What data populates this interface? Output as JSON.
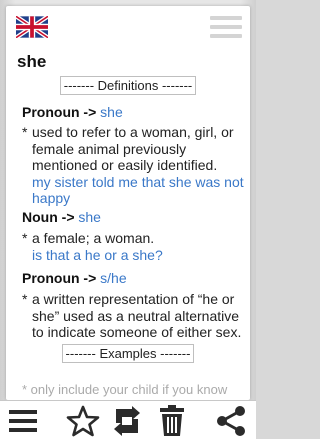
{
  "header": {
    "flag_icon": "uk-flag-icon",
    "menu_icon": "menu-lines-icon"
  },
  "entry": {
    "word": "she",
    "definitions_label": "------- Definitions -------",
    "examples_label": "------- Examples -------",
    "truncated_text": "* only include your child if you know"
  },
  "senses": [
    {
      "label": "Pronoun ->",
      "link": "she",
      "definition": "used to refer to a woman, girl, or female animal previously mentioned or easily identified.",
      "example": "my sister told me that she was not happy"
    },
    {
      "label": "Noun ->",
      "link": "she",
      "definition": "a female; a woman.",
      "example": "is that a he or a she?"
    },
    {
      "label": "Pronoun ->",
      "link": "s/he",
      "definition": "a written representation of “he or she” used as a neutral alternative to indicate someone of either sex.",
      "example": ""
    }
  ],
  "bullet": "*",
  "toolbar": {
    "items": [
      "menu-icon",
      "star-icon",
      "swap-icon",
      "trash-icon",
      "share-icon"
    ]
  },
  "colors": {
    "link": "#3a78c8",
    "text": "#222222",
    "toolbar_icon": "#2b2b2b"
  }
}
